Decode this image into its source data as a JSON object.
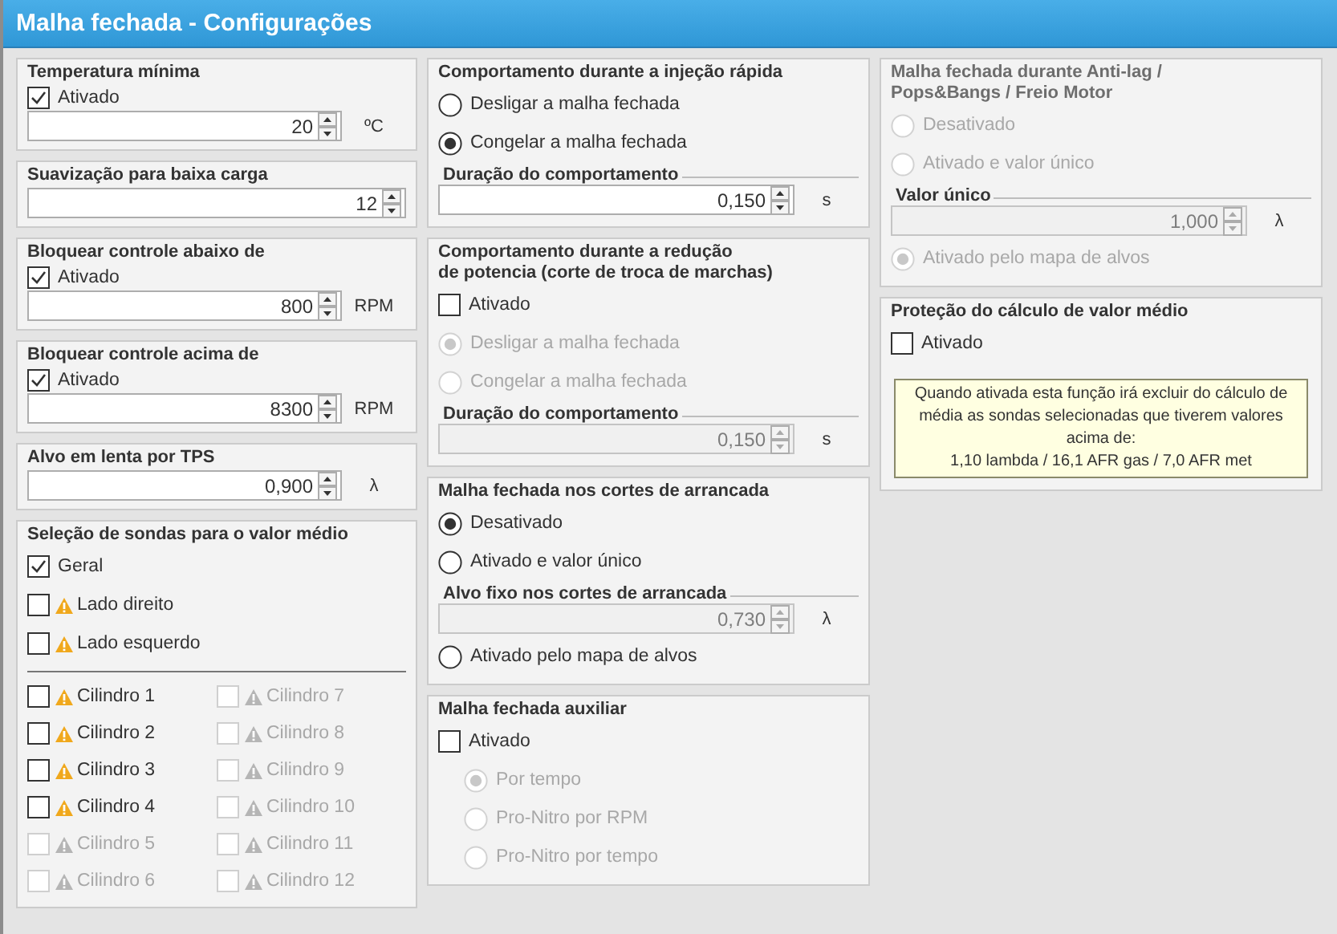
{
  "window": {
    "title": "Malha fechada - Configurações"
  },
  "columns": [
    {
      "panels": [
        {
          "title": "Temperatura mínima",
          "disabled": false,
          "rows": [
            {
              "kind": "checkbox",
              "label": "Ativado",
              "checked": true,
              "disabled": false
            },
            {
              "kind": "spin",
              "value": "20",
              "unit": "ºC",
              "disabled": false
            }
          ]
        },
        {
          "title": "Suavização para baixa carga",
          "disabled": false,
          "rows": [
            {
              "kind": "spin",
              "value": "12",
              "disabled": false
            }
          ]
        },
        {
          "title": "Bloquear controle abaixo de",
          "disabled": false,
          "rows": [
            {
              "kind": "checkbox",
              "label": "Ativado",
              "checked": true,
              "disabled": false
            },
            {
              "kind": "spin",
              "value": "800",
              "unit": "RPM",
              "disabled": false
            }
          ]
        },
        {
          "title": "Bloquear controle acima de",
          "disabled": false,
          "rows": [
            {
              "kind": "checkbox",
              "label": "Ativado",
              "checked": true,
              "disabled": false
            },
            {
              "kind": "spin",
              "value": "8300",
              "unit": "RPM",
              "disabled": false
            }
          ]
        },
        {
          "title": "Alvo em lenta por TPS",
          "disabled": false,
          "rows": [
            {
              "kind": "spin",
              "value": "0,900",
              "unit": "λ",
              "disabled": false
            }
          ]
        },
        {
          "title": "Seleção de sondas para o valor médio",
          "disabled": false,
          "rows": [
            {
              "kind": "checkbox",
              "label": "Geral",
              "checked": true,
              "disabled": false
            },
            {
              "kind": "checkbox",
              "label": "Lado direito",
              "checked": false,
              "disabled": false,
              "warning": true
            },
            {
              "kind": "checkbox",
              "label": "Lado esquerdo",
              "checked": false,
              "disabled": false,
              "warning": true
            },
            {
              "kind": "divider"
            },
            {
              "kind": "grid",
              "items": [
                {
                  "label": "Cilindro 1",
                  "checked": false,
                  "disabled": false,
                  "warning": true
                },
                {
                  "label": "Cilindro 2",
                  "checked": false,
                  "disabled": false,
                  "warning": true
                },
                {
                  "label": "Cilindro 3",
                  "checked": false,
                  "disabled": false,
                  "warning": true
                },
                {
                  "label": "Cilindro 4",
                  "checked": false,
                  "disabled": false,
                  "warning": true
                },
                {
                  "label": "Cilindro 5",
                  "checked": false,
                  "disabled": true,
                  "warning": true
                },
                {
                  "label": "Cilindro 6",
                  "checked": false,
                  "disabled": true,
                  "warning": true
                },
                {
                  "label": "Cilindro 7",
                  "checked": false,
                  "disabled": true,
                  "warning": true
                },
                {
                  "label": "Cilindro 8",
                  "checked": false,
                  "disabled": true,
                  "warning": true
                },
                {
                  "label": "Cilindro 9",
                  "checked": false,
                  "disabled": true,
                  "warning": true
                },
                {
                  "label": "Cilindro 10",
                  "checked": false,
                  "disabled": true,
                  "warning": true
                },
                {
                  "label": "Cilindro 11",
                  "checked": false,
                  "disabled": true,
                  "warning": true
                },
                {
                  "label": "Cilindro 12",
                  "checked": false,
                  "disabled": true,
                  "warning": true
                }
              ]
            }
          ]
        }
      ]
    },
    {
      "panels": [
        {
          "title": "Comportamento durante a injeção rápida",
          "disabled": false,
          "rows": [
            {
              "kind": "radio",
              "label": "Desligar a malha fechada",
              "selected": false,
              "disabled": false
            },
            {
              "kind": "radio",
              "label": "Congelar a malha fechada",
              "selected": true,
              "disabled": false
            },
            {
              "kind": "spin",
              "caption": "Duração do comportamento",
              "value": "0,150",
              "unit": "s",
              "disabled": false
            }
          ]
        },
        {
          "title": "Comportamento durante a redução\nde potencia (corte de troca de marchas)",
          "disabled": false,
          "rows": [
            {
              "kind": "checkbox",
              "label": "Ativado",
              "checked": false,
              "disabled": false
            },
            {
              "kind": "radio",
              "label": "Desligar a malha fechada",
              "selected": true,
              "disabled": true
            },
            {
              "kind": "radio",
              "label": "Congelar a malha fechada",
              "selected": false,
              "disabled": true
            },
            {
              "kind": "spin",
              "caption": "Duração do comportamento",
              "value": "0,150",
              "unit": "s",
              "disabled": true
            }
          ]
        },
        {
          "title": "Malha fechada nos cortes de arrancada",
          "disabled": false,
          "rows": [
            {
              "kind": "radio",
              "label": "Desativado",
              "selected": true,
              "disabled": false
            },
            {
              "kind": "radio",
              "label": "Ativado e valor único",
              "selected": false,
              "disabled": false,
              "children": [
                {
                  "kind": "spin",
                  "caption": "Alvo fixo nos cortes de arrancada",
                  "value": "0,730",
                  "unit": "λ",
                  "disabled": true
                }
              ]
            },
            {
              "kind": "radio",
              "label": "Ativado pelo mapa de alvos",
              "selected": false,
              "disabled": false
            }
          ]
        },
        {
          "title": "Malha fechada auxiliar",
          "disabled": false,
          "rows": [
            {
              "kind": "checkbox",
              "label": "Ativado",
              "checked": false,
              "disabled": false,
              "children": [
                {
                  "kind": "radio",
                  "label": "Por tempo",
                  "selected": true,
                  "disabled": true
                },
                {
                  "kind": "radio",
                  "label": "Pro-Nitro por RPM",
                  "selected": false,
                  "disabled": true
                },
                {
                  "kind": "radio",
                  "label": "Pro-Nitro por tempo",
                  "selected": false,
                  "disabled": true
                }
              ]
            }
          ]
        }
      ]
    },
    {
      "panels": [
        {
          "title": "Malha fechada durante Anti-lag /\nPops&Bangs / Freio Motor",
          "disabled": true,
          "rows": [
            {
              "kind": "radio",
              "label": "Desativado",
              "selected": false,
              "disabled": true
            },
            {
              "kind": "radio",
              "label": "Ativado e valor único",
              "selected": false,
              "disabled": true,
              "children": [
                {
                  "kind": "spin",
                  "caption": "Valor único",
                  "value": "1,000",
                  "unit": "λ",
                  "disabled": true
                }
              ]
            },
            {
              "kind": "radio",
              "label": "Ativado pelo mapa de alvos",
              "selected": true,
              "disabled": true
            }
          ]
        },
        {
          "title": "Proteção do cálculo de valor médio",
          "disabled": false,
          "rows": [
            {
              "kind": "checkbox",
              "label": "Ativado",
              "checked": false,
              "disabled": false
            },
            {
              "kind": "note",
              "text": "Quando ativada esta função irá excluir do cálculo de\nmédia as sondas selecionadas que tiverem valores\nacima de:\n1,10 lambda / 16,1 AFR gas / 7,0 AFR met"
            }
          ]
        }
      ]
    }
  ]
}
